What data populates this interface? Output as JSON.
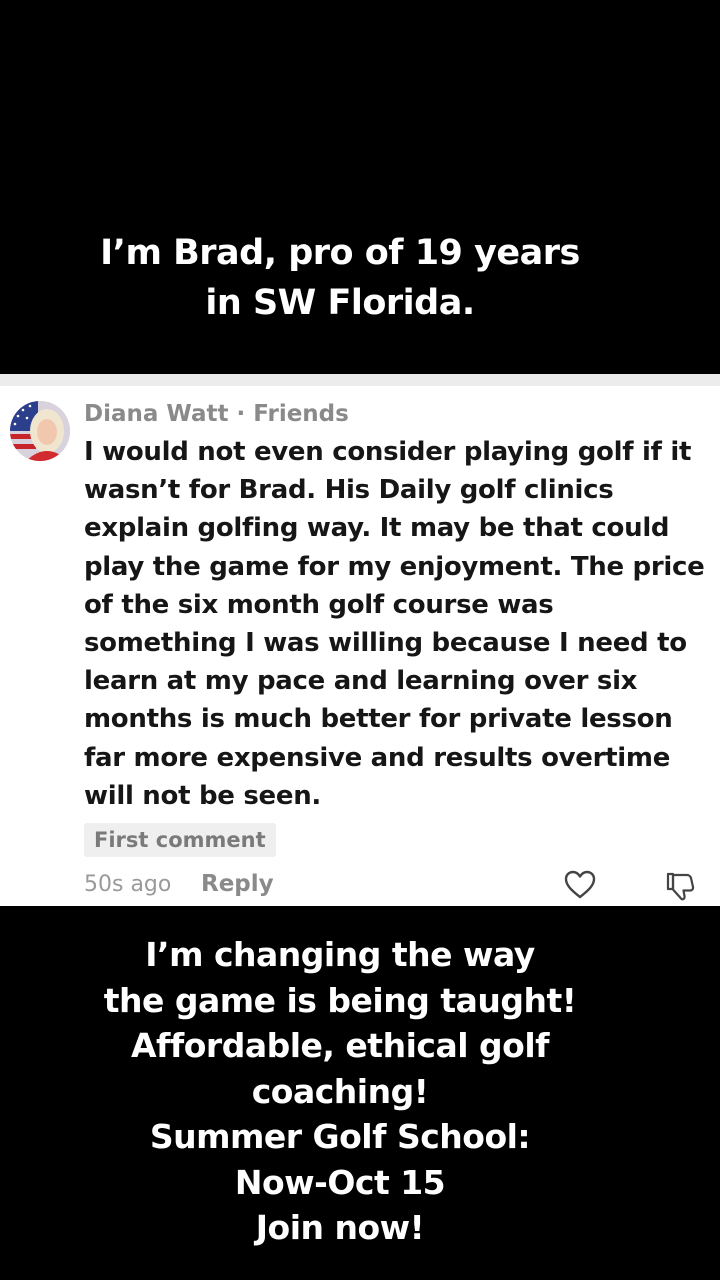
{
  "top_caption": {
    "lines": [
      "I’m Brad, pro of 19 years",
      "in SW Florida."
    ]
  },
  "comment": {
    "author": "Diana Watt",
    "separator": " · ",
    "relation": "Friends",
    "text_lines": [
      "I would not even consider playing golf if it",
      "wasn’t for Brad. His Daily golf clinics",
      "explain golfing way. It may be that could",
      "play the game for my enjoyment. The price",
      "of the six month golf course was",
      "something I was willing because I need to",
      "learn at my pace and learning over six",
      "months is much better for private lesson",
      "far more expensive and results overtime",
      "will not be seen."
    ],
    "tag": "First comment",
    "timestamp": "50s ago",
    "reply_label": "Reply",
    "like_icon": "heart-outline-icon",
    "dislike_icon": "thumbs-down-outline-icon"
  },
  "bottom_caption": {
    "lines": [
      "I’m changing the way",
      "the game is being taught!",
      "Affordable, ethical golf",
      "coaching!",
      "Summer Golf School:",
      "Now-Oct 15",
      "Join now!"
    ]
  },
  "colors": {
    "background": "#000000",
    "caption_text": "#ffffff",
    "card_background": "#ffffff",
    "comment_text": "#161616",
    "muted_text": "#8a8a8a"
  }
}
